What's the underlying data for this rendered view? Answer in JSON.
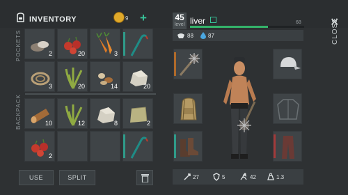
{
  "inventory": {
    "title": "INVENTORY",
    "coins": "9",
    "pockets_label": "POCKETS",
    "backpack_label": "BACKPACK"
  },
  "pockets": [
    {
      "icon": "stones-icon",
      "count": "2"
    },
    {
      "icon": "berries-icon",
      "count": "20"
    },
    {
      "icon": "carrots-icon",
      "count": "3"
    },
    {
      "icon": "crowbar-icon",
      "count": ""
    },
    {
      "icon": "rope-icon",
      "count": "3"
    },
    {
      "icon": "plant-fiber-icon",
      "count": "20"
    },
    {
      "icon": "seeds-icon",
      "count": "14"
    },
    {
      "icon": "stone-icon",
      "count": "20"
    }
  ],
  "backpack": [
    {
      "icon": "log-icon",
      "count": "10"
    },
    {
      "icon": "plant-fiber-icon",
      "count": "12"
    },
    {
      "icon": "stone-icon",
      "count": "8"
    },
    {
      "icon": "cloth-icon",
      "count": "2"
    },
    {
      "icon": "berries-icon",
      "count": "2"
    },
    {
      "icon": "",
      "count": ""
    },
    {
      "icon": "",
      "count": ""
    },
    {
      "icon": "crowbar-icon",
      "count": ""
    }
  ],
  "buttons": {
    "use": "USE",
    "split": "SPLIT"
  },
  "player": {
    "level": "45",
    "level_label": "level",
    "name": "liver",
    "xp_value": "68",
    "xp_fraction": 0.68
  },
  "stats_top": {
    "food": "88",
    "water": "87"
  },
  "stats_bottom": {
    "attack": "27",
    "defense": "5",
    "speed": "42",
    "weight": "1.3"
  },
  "close": {
    "label": "CLOSE"
  },
  "equipment": {
    "left": [
      "spiked-club-icon",
      "backpack-icon",
      "boots-icon"
    ],
    "right": [
      "cap-icon",
      "jacket-icon",
      "pants-icon"
    ]
  },
  "colors": {
    "accent": "#37c59a",
    "xp": "#34b36a",
    "slot": "#3f4447"
  }
}
